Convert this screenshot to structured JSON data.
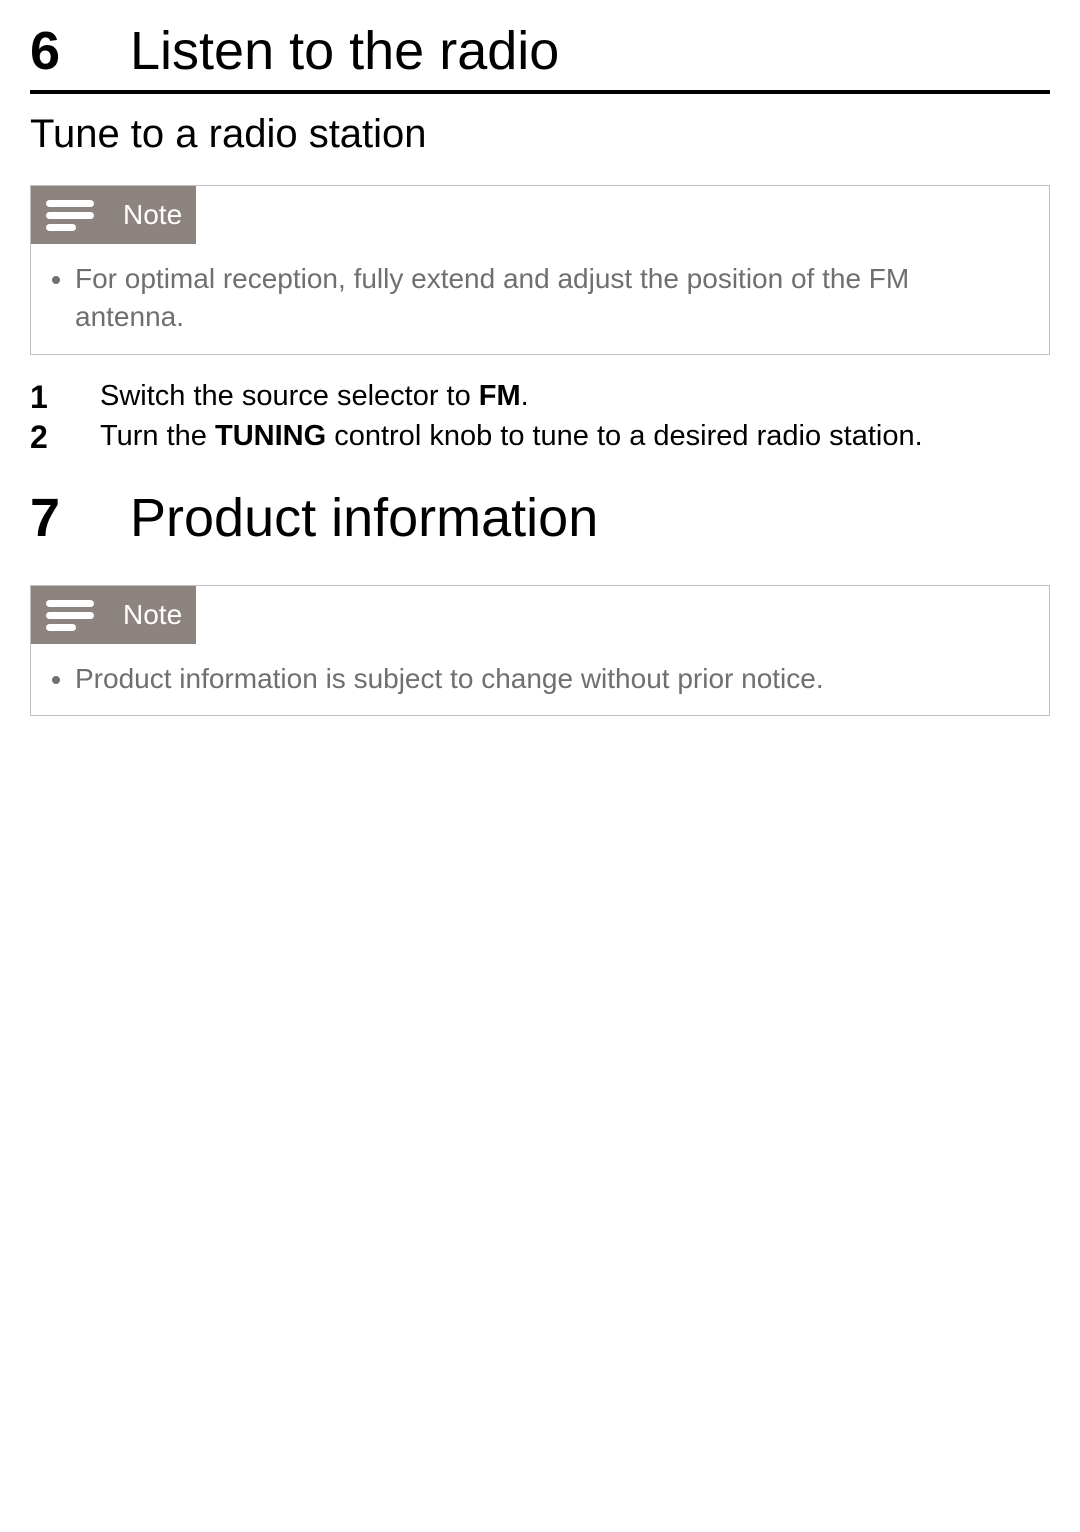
{
  "sections": [
    {
      "number": "6",
      "title": "Listen to the radio",
      "subtitle": "Tune to a radio station",
      "note": {
        "label": "Note",
        "items": [
          "For optimal reception, fully extend and adjust the position of the FM antenna."
        ]
      },
      "steps": [
        {
          "num": "1",
          "text_pre": "Switch the source selector to ",
          "bold": "FM",
          "text_post": "."
        },
        {
          "num": "2",
          "text_pre": "Turn the ",
          "bold": "TUNING",
          "text_post": " control knob to tune to a desired radio station."
        }
      ]
    },
    {
      "number": "7",
      "title": "Product information",
      "note": {
        "label": "Note",
        "items": [
          "Product information is subject to change without prior notice."
        ]
      }
    }
  ]
}
